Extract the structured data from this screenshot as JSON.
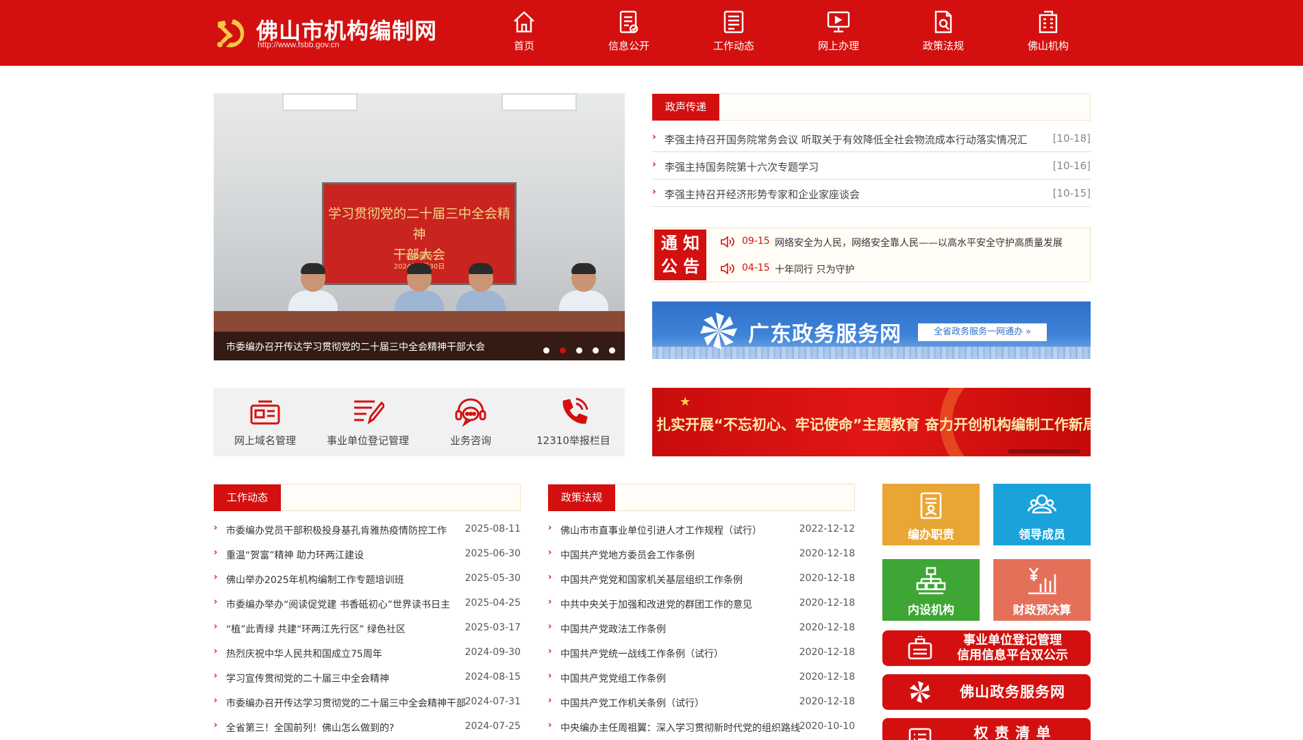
{
  "header": {
    "site_title": "佛山市机构编制网",
    "site_url": "http://www.fsbb.gov.cn",
    "nav": [
      {
        "label": "首页",
        "icon": "home-icon"
      },
      {
        "label": "信息公开",
        "icon": "document-icon"
      },
      {
        "label": "工作动态",
        "icon": "news-icon"
      },
      {
        "label": "网上办理",
        "icon": "monitor-icon"
      },
      {
        "label": "政策法规",
        "icon": "policy-file-icon"
      },
      {
        "label": "佛山机构",
        "icon": "building-icon"
      }
    ]
  },
  "carousel": {
    "screen_title_line1": "学习贯彻党的二十届三中全会精神",
    "screen_title_line2": "干部大会",
    "screen_sub_line1": "市委编办",
    "screen_sub_line2": "2024年7月30日",
    "caption": "市委编办召开传达学习贯彻党的二十届三中全会精神干部大会",
    "slide_count": 5,
    "active_slide": 2
  },
  "zsc": {
    "heading": "政声传递",
    "items": [
      {
        "title": "李强主持召开国务院常务会议 听取关于有效降低全社会物流成本行动落实情况汇",
        "date": "[10-18]"
      },
      {
        "title": "李强主持国务院第十六次专题学习",
        "date": "[10-16]"
      },
      {
        "title": "李强主持召开经济形势专家和企业家座谈会",
        "date": "[10-15]"
      }
    ]
  },
  "notice": {
    "badge_line1": "通 知",
    "badge_line2": "公 告",
    "items": [
      {
        "date": "09-15",
        "text": "网络安全为人民，网络安全靠人民——以高水平安全守护高质量发展"
      },
      {
        "date": "04-15",
        "text": "十年同行 只为守护"
      }
    ]
  },
  "gd_banner": {
    "title": "广东政务服务网",
    "button": "全省政务服务一网通办 »"
  },
  "quick_services": [
    {
      "label": "网上域名管理",
      "icon": "id-card-icon"
    },
    {
      "label": "事业单位登记管理",
      "icon": "edit-list-icon"
    },
    {
      "label": "业务咨询",
      "icon": "chat-headset-icon"
    },
    {
      "label": "12310举报栏目",
      "icon": "phone-icon"
    }
  ],
  "theme_banner": {
    "text": "扎实开展“不忘初心、牢记使命”主题教育 奋力开创机构编制工作新局面"
  },
  "work": {
    "heading": "工作动态",
    "items": [
      {
        "title": "市委编办党员干部积极投身基孔肯雅热疫情防控工作",
        "date": "2025-08-11"
      },
      {
        "title": "重温“贺富”精神 助力环两江建设",
        "date": "2025-06-30"
      },
      {
        "title": "佛山举办2025年机构编制工作专题培训班",
        "date": "2025-05-30"
      },
      {
        "title": "市委编办举办“阅读促党建 书香砥初心”世界读书日主",
        "date": "2025-04-25"
      },
      {
        "title": "“植”此青绿 共建“环两江先行区” 绿色社区",
        "date": "2025-03-17"
      },
      {
        "title": "热烈庆祝中华人民共和国成立75周年",
        "date": "2024-09-30"
      },
      {
        "title": "学习宣传贯彻党的二十届三中全会精神",
        "date": "2024-08-15"
      },
      {
        "title": "市委编办召开传达学习贯彻党的二十届三中全会精神干部",
        "date": "2024-07-31"
      },
      {
        "title": "全省第三！全国前列！佛山怎么做到的?",
        "date": "2024-07-25"
      }
    ]
  },
  "policy": {
    "heading": "政策法规",
    "items": [
      {
        "title": "佛山市市直事业单位引进人才工作规程（试行）",
        "date": "2022-12-12"
      },
      {
        "title": "中国共产党地方委员会工作条例",
        "date": "2020-12-18"
      },
      {
        "title": "中国共产党党和国家机关基层组织工作条例",
        "date": "2020-12-18"
      },
      {
        "title": "中共中央关于加强和改进党的群团工作的意见",
        "date": "2020-12-18"
      },
      {
        "title": "中国共产党政法工作条例",
        "date": "2020-12-18"
      },
      {
        "title": "中国共产党统一战线工作条例（试行）",
        "date": "2020-12-18"
      },
      {
        "title": "中国共产党党组工作条例",
        "date": "2020-12-18"
      },
      {
        "title": "中国共产党工作机关条例（试行）",
        "date": "2020-12-18"
      },
      {
        "title": "中央编办主任周祖翼：深入学习贯彻新时代党的组织路线",
        "date": "2020-10-10"
      }
    ]
  },
  "tiles": [
    {
      "label": "编办职责",
      "icon": "duty-icon",
      "color": "#e9a634"
    },
    {
      "label": "领导成员",
      "icon": "leaders-icon",
      "color": "#1aa3db"
    },
    {
      "label": "内设机构",
      "icon": "org-chart-icon",
      "color": "#3da635"
    },
    {
      "label": "财政预决算",
      "icon": "finance-chart-icon",
      "color": "#e4705a"
    }
  ],
  "wide_buttons": [
    {
      "line1": "事业单位登记管理",
      "line2": "信用信息平台双公示",
      "icon": "briefcase-icon"
    },
    {
      "line1": "佛山政务服务网",
      "icon": "service-flower-icon"
    },
    {
      "line1": "权 责 清 单",
      "icon": "list-icon"
    }
  ],
  "colors": {
    "brand_red": "#d3100f",
    "tile_orange": "#e9a634",
    "tile_blue": "#1aa3db",
    "tile_green": "#3da635",
    "tile_coral": "#e4705a"
  }
}
